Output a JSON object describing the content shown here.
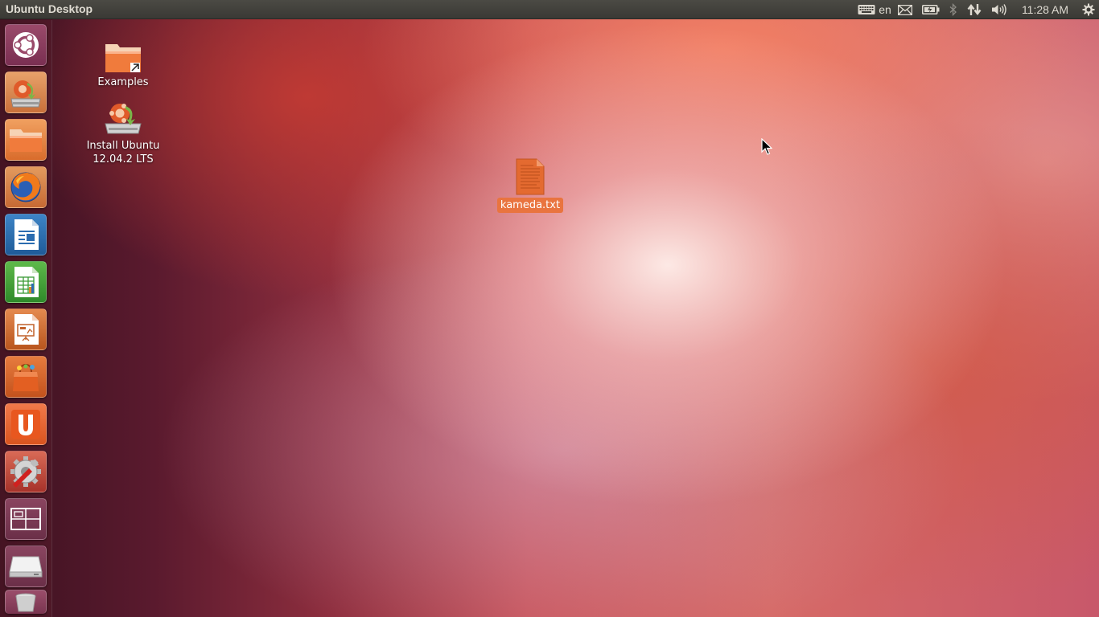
{
  "top_panel": {
    "title": "Ubuntu Desktop",
    "keyboard_layout": "en",
    "clock": "11:28 AM",
    "indicators": [
      "keyboard-icon",
      "mail-icon",
      "battery-icon",
      "bluetooth-icon",
      "network-icon",
      "volume-icon",
      "gear-icon"
    ]
  },
  "launcher": {
    "items": [
      {
        "name": "dash-home",
        "icon": "ubuntu-logo-icon"
      },
      {
        "name": "install-ubuntu",
        "icon": "installer-icon"
      },
      {
        "name": "files",
        "icon": "folder-icon"
      },
      {
        "name": "firefox",
        "icon": "firefox-icon"
      },
      {
        "name": "libreoffice-writer",
        "icon": "writer-icon"
      },
      {
        "name": "libreoffice-calc",
        "icon": "calc-icon"
      },
      {
        "name": "libreoffice-impress",
        "icon": "impress-icon"
      },
      {
        "name": "software-center",
        "icon": "shopping-bag-icon"
      },
      {
        "name": "ubuntu-one",
        "icon": "ubuntu-one-icon"
      },
      {
        "name": "system-settings",
        "icon": "settings-icon"
      },
      {
        "name": "workspace-switcher",
        "icon": "workspace-icon"
      },
      {
        "name": "drive",
        "icon": "drive-icon"
      },
      {
        "name": "trash",
        "icon": "trash-icon"
      }
    ]
  },
  "desktop": {
    "icons": [
      {
        "label": "Examples",
        "icon": "folder-link-icon"
      },
      {
        "label": "Install Ubuntu 12.04.2 LTS",
        "label_line1": "Install Ubuntu",
        "label_line2": "12.04.2 LTS",
        "icon": "installer-icon"
      },
      {
        "label": "kameda.txt",
        "icon": "text-file-icon",
        "selected": true
      }
    ]
  },
  "colors": {
    "panel_bg": "#3c3b37",
    "selection": "#e9743f",
    "accent": "#dd4814"
  }
}
